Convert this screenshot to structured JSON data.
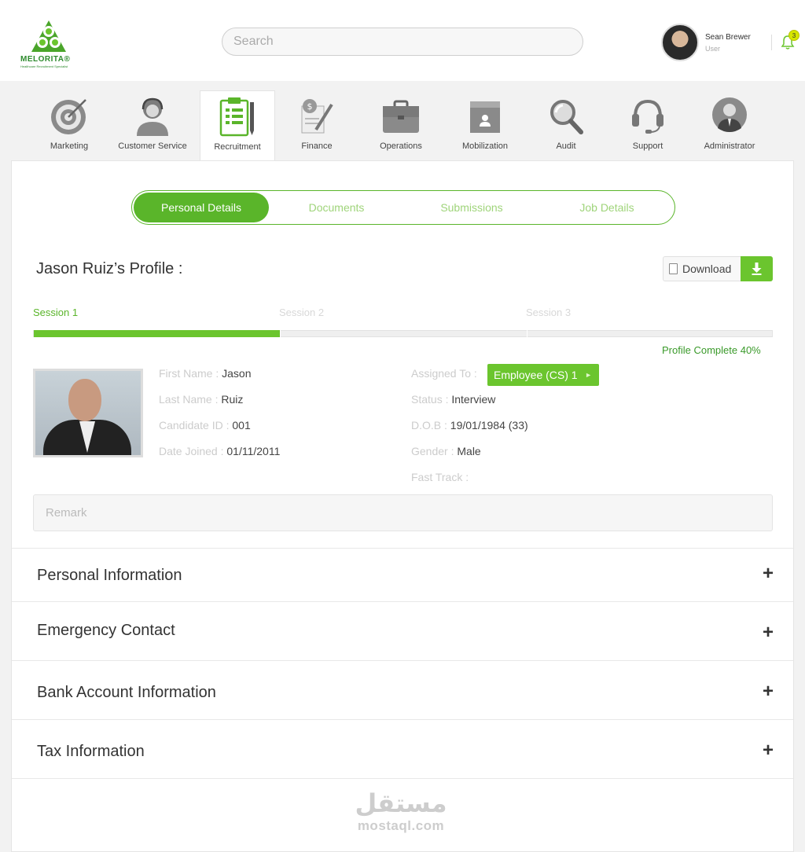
{
  "header": {
    "logo_text": "MELORITA®",
    "logo_tagline": "Healthcare Recruitment Specialist",
    "search_placeholder": "Search",
    "user_name": "Sean Brewer",
    "user_role": "User",
    "notification_count": "3"
  },
  "modules": [
    {
      "label": "Marketing",
      "icon": "target-icon"
    },
    {
      "label": "Customer Service",
      "icon": "agent-icon"
    },
    {
      "label": "Recruitment",
      "icon": "clipboard-icon",
      "active": true
    },
    {
      "label": "Finance",
      "icon": "finance-pen-icon"
    },
    {
      "label": "Operations",
      "icon": "briefcase-icon"
    },
    {
      "label": "Mobilization",
      "icon": "id-folder-icon"
    },
    {
      "label": "Audit",
      "icon": "magnifier-icon"
    },
    {
      "label": "Support",
      "icon": "headset-icon"
    },
    {
      "label": "Administrator",
      "icon": "admin-user-icon"
    }
  ],
  "tabs": [
    {
      "label": "Personal Details",
      "active": true
    },
    {
      "label": "Documents"
    },
    {
      "label": "Submissions"
    },
    {
      "label": "Job Details"
    }
  ],
  "profile": {
    "title": "Jason Ruiz’s Profile :",
    "download_label": "Download",
    "sessions": [
      "Session 1",
      "Session 2",
      "Session 3"
    ],
    "active_session": "Session 1",
    "progress_fraction": 0.333,
    "progress_text": "Profile Complete 40%",
    "fields_left": [
      {
        "label": "First Name : ",
        "value": "Jason"
      },
      {
        "label": "Last Name : ",
        "value": "Ruiz"
      },
      {
        "label": "Candidate ID : ",
        "value": "001"
      },
      {
        "label": "Date Joined : ",
        "value": "01/11/2011"
      }
    ],
    "assigned_label": "Assigned To :",
    "assigned_value": "Employee (CS) 1",
    "fields_right": [
      {
        "label": "Status : ",
        "value": "Interview"
      },
      {
        "label": "D.O.B : ",
        "value": "19/01/1984 (33)"
      },
      {
        "label": "Gender : ",
        "value": "Male"
      },
      {
        "label": "Fast Track : ",
        "value": ""
      }
    ],
    "remark_placeholder": "Remark"
  },
  "sections": [
    {
      "label": "Personal Information"
    },
    {
      "label": "Emergency Contact"
    },
    {
      "label": "Bank Account Information"
    },
    {
      "label": "Tax Information"
    }
  ],
  "watermark": {
    "arabic": "مستقل",
    "latin": "mostaql.com"
  },
  "colors": {
    "accent": "#5ab52a",
    "accent_light": "#9fd47a",
    "button": "#6bc52e"
  }
}
